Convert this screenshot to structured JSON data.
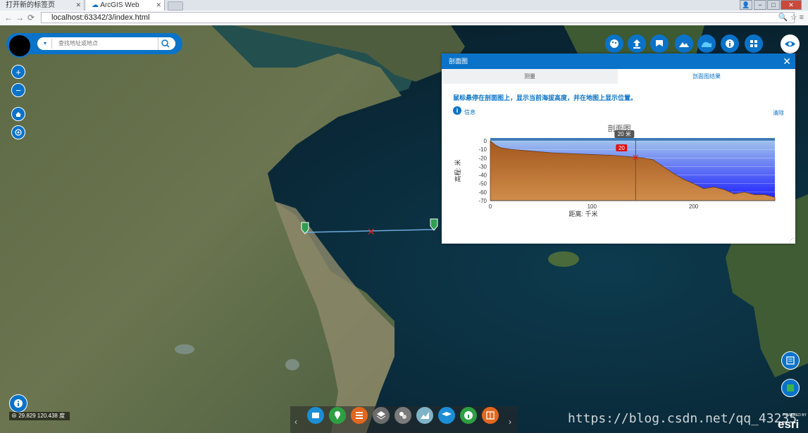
{
  "browser": {
    "tabs": [
      {
        "label": "打开新的标签页"
      },
      {
        "label": "ArcGIS Web Applic"
      }
    ],
    "url": "localhost:63342/3/index.html"
  },
  "search": {
    "placeholder": "查找地址或地点"
  },
  "panel": {
    "title": "剖面图",
    "tab_measure": "测量",
    "tab_result": "剖面图结果",
    "hint": "鼠标悬停在剖面图上，显示当前海拔高度，并在地图上显示位置。",
    "info_label": "信息",
    "clear_label": "清除"
  },
  "chart_data": {
    "type": "area",
    "title": "剖面图",
    "xlabel": "距离: 千米",
    "ylabel": "高程: 米",
    "xlim": [
      0,
      280
    ],
    "ylim": [
      -70,
      0
    ],
    "xticks": [
      "0",
      "100",
      "200"
    ],
    "yticks": [
      "0",
      "-10",
      "-20",
      "-30",
      "-40",
      "-50",
      "-60",
      "-70"
    ],
    "x": [
      0,
      5,
      10,
      20,
      40,
      60,
      80,
      100,
      120,
      140,
      150,
      160,
      170,
      180,
      190,
      200,
      210,
      220,
      230,
      240,
      250,
      260,
      270,
      280
    ],
    "y": [
      0,
      -5,
      -8,
      -10,
      -12,
      -14,
      -15,
      -16,
      -17,
      -19,
      -20,
      -22,
      -30,
      -38,
      -45,
      -50,
      -56,
      -54,
      -57,
      -62,
      -60,
      -63,
      -63,
      -66
    ],
    "cursor_x": 143,
    "cursor_label": "20 米",
    "cursor_badge": "20"
  },
  "status": {
    "coords": "29.829 120.438 度"
  },
  "watermark": "https://blog.csdn.net/qq_43235",
  "brand": {
    "logo": "esri",
    "powered_by": "POWERED BY"
  },
  "colors": {
    "accent": "#0a73c9",
    "terrain": "#b5651d",
    "water": "#1b2cff"
  }
}
